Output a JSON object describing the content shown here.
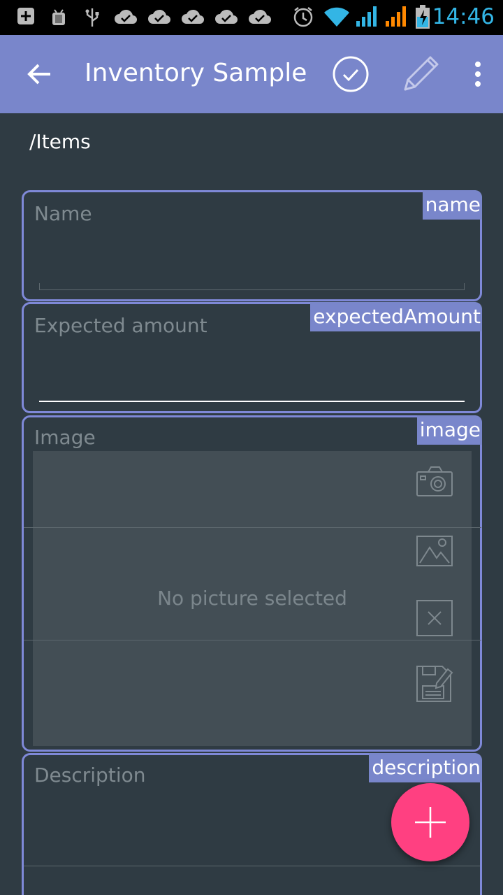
{
  "status_bar": {
    "time": "14:46",
    "icons": [
      "add-box-icon",
      "android-debug-icon",
      "usb-icon",
      "cloud-done-icon",
      "cloud-done-icon",
      "cloud-done-icon",
      "cloud-done-icon",
      "cloud-done-icon",
      "alarm-icon",
      "wifi-icon",
      "signal-icon",
      "signal-icon",
      "battery-charging-icon"
    ],
    "time_color": "#33b5e5"
  },
  "app_bar": {
    "title": "Inventory Sample",
    "color": "#7986cb",
    "actions": [
      "check-circle-icon",
      "pencil-icon",
      "more-vert-icon"
    ]
  },
  "path": "/Items",
  "fields": {
    "name": {
      "label": "Name",
      "tag": "name"
    },
    "expected_amount": {
      "label": "Expected amount",
      "tag": "expectedAmount"
    },
    "image": {
      "label": "Image",
      "tag": "image",
      "placeholder": "No picture selected",
      "actions": [
        "camera-icon",
        "gallery-icon",
        "clear-icon",
        "save-edit-icon"
      ]
    },
    "description": {
      "label": "Description",
      "tag": "description"
    }
  },
  "fab": {
    "icon": "plus-icon",
    "color": "#ff4081"
  },
  "accent_border": "#7f89d8",
  "background": "#2f3b43"
}
